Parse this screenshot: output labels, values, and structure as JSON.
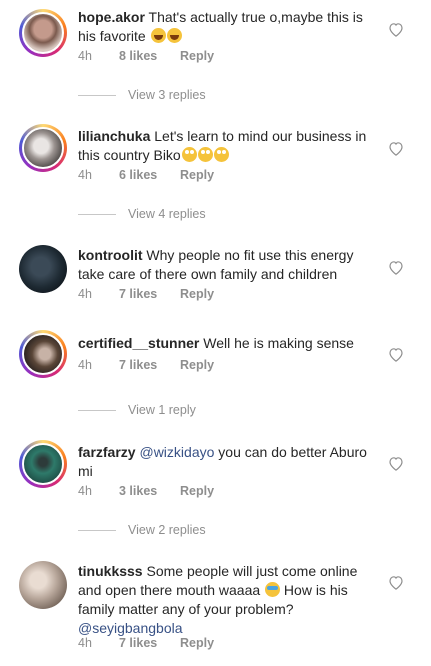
{
  "colors": {
    "accent_link": "#385185",
    "meta_gray": "#8e8e8e",
    "text": "#262626"
  },
  "comments": [
    {
      "username": "hope.akor",
      "text": " That's actually true o,maybe this is his favorite ",
      "emoji": "laughing-face",
      "emoji_count": 2,
      "time": "4h",
      "likes": "8 likes",
      "reply": "Reply",
      "view_replies": "View 3 replies"
    },
    {
      "username": "lilianchuka",
      "text": " Let's learn to mind our business in this country Biko",
      "emoji": "eye-roll-face",
      "emoji_count": 3,
      "time": "4h",
      "likes": "6 likes",
      "reply": "Reply",
      "view_replies": "View 4 replies"
    },
    {
      "username": "kontroolit",
      "text": " Why people no fit use this energy take care of there own family and children",
      "time": "4h",
      "likes": "7 likes",
      "reply": "Reply"
    },
    {
      "username": "certified__stunner",
      "text": " Well he is making sense",
      "time": "4h",
      "likes": "7 likes",
      "reply": "Reply",
      "view_replies": "View 1 reply"
    },
    {
      "username": "farzfarzy",
      "mention": "@wizkidayo",
      "text": " you can do better Aburo mi",
      "time": "4h",
      "likes": "3 likes",
      "reply": "Reply",
      "view_replies": "View 2 replies"
    },
    {
      "username": "tinukksss",
      "text": " Some people will just come online and open there mouth waaaa ",
      "emoji": "crying-face",
      "text_after": " How is his family matter any of your problem?",
      "mention_after": "@seyigbangbola",
      "time": "4h",
      "likes": "7 likes",
      "reply": "Reply"
    }
  ]
}
